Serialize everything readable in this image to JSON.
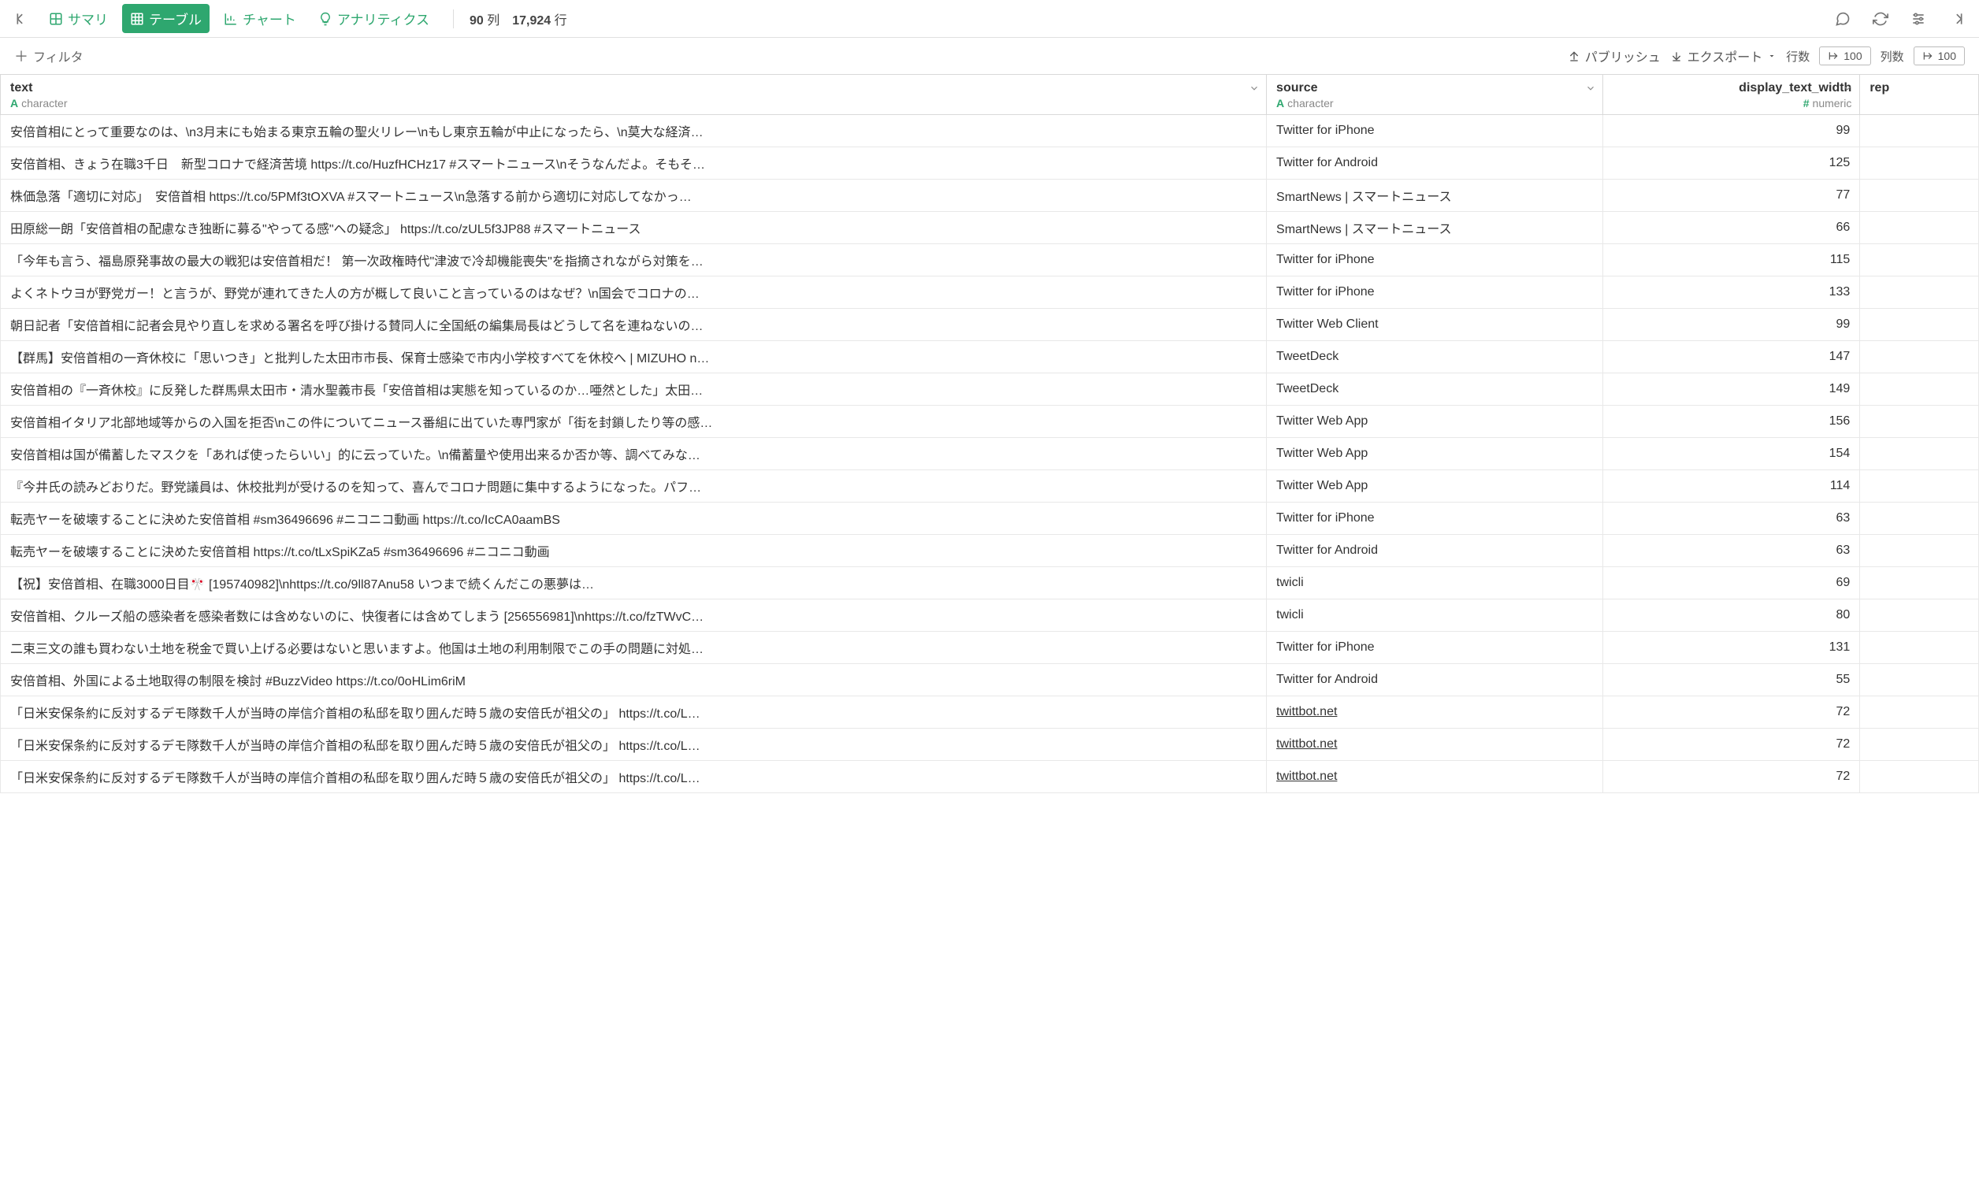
{
  "toolbar": {
    "back_label": "戻る",
    "tabs": {
      "summary": "サマリ",
      "table": "テーブル",
      "chart": "チャート",
      "analytics": "アナリティクス"
    },
    "columns_count": "90",
    "columns_unit": "列",
    "rows_count": "17,924",
    "rows_unit": "行"
  },
  "secondbar": {
    "filter_label": "フィルタ",
    "publish_label": "パブリッシュ",
    "export_label": "エクスポート",
    "rows_label": "行数",
    "cols_label": "列数",
    "rows_value": "100",
    "cols_value": "100"
  },
  "columns": [
    {
      "name": "text",
      "type_label": "character",
      "type_kind": "character"
    },
    {
      "name": "source",
      "type_label": "character",
      "type_kind": "character"
    },
    {
      "name": "display_text_width",
      "type_label": "numeric",
      "type_kind": "numeric"
    },
    {
      "name": "rep",
      "type_label": "",
      "type_kind": ""
    }
  ],
  "rows": [
    {
      "text": "安倍首相にとって重要なのは、\\n3月末にも始まる東京五輪の聖火リレー\\nもし東京五輪が中止になったら、\\n莫大な経済…",
      "source": "Twitter for iPhone",
      "source_link": false,
      "width": "99"
    },
    {
      "text": "安倍首相、きょう在職3千日　新型コロナで経済苦境 https://t.co/HuzfHCHz17 #スマートニュース\\nそうなんだよ。そもそ…",
      "source": "Twitter for Android",
      "source_link": false,
      "width": "125"
    },
    {
      "text": "株価急落「適切に対応」　安倍首相 https://t.co/5PMf3tOXVA #スマートニュース\\n急落する前から適切に対応してなかっ…",
      "source": "SmartNews | スマートニュース",
      "source_link": false,
      "width": "77"
    },
    {
      "text": "田原総一朗「安倍首相の配慮なき独断に募る\"やってる感\"への疑念」 https://t.co/zUL5f3JP88 #スマートニュース",
      "source": "SmartNews | スマートニュース",
      "source_link": false,
      "width": "66"
    },
    {
      "text": "「今年も言う、福島原発事故の最大の戦犯は安倍首相だ！ 第一次政権時代\"津波で冷却機能喪失\"を指摘されながら対策を…",
      "source": "Twitter for iPhone",
      "source_link": false,
      "width": "115"
    },
    {
      "text": "よくネトウヨが野党ガー！と言うが、野党が連れてきた人の方が概して良いこと言っているのはなぜ？\\n国会でコロナの…",
      "source": "Twitter for iPhone",
      "source_link": false,
      "width": "133"
    },
    {
      "text": "朝日記者「安倍首相に記者会見やり直しを求める署名を呼び掛ける賛同人に全国紙の編集局長はどうして名を連ねないの…",
      "source": "Twitter Web Client",
      "source_link": false,
      "width": "99"
    },
    {
      "text": "【群馬】安倍首相の一斉休校に「思いつき」と批判した太田市市長、保育士感染で市内小学校すべてを休校へ | MIZUHO n…",
      "source": "TweetDeck",
      "source_link": false,
      "width": "147"
    },
    {
      "text": "安倍首相の『一斉休校』に反発した群馬県太田市・清水聖義市長「安倍首相は実態を知っているのか…唖然とした」太田…",
      "source": "TweetDeck",
      "source_link": false,
      "width": "149"
    },
    {
      "text": "安倍首相イタリア北部地域等からの入国を拒否\\nこの件についてニュース番組に出ていた専門家が「街を封鎖したり等の感…",
      "source": "Twitter Web App",
      "source_link": false,
      "width": "156"
    },
    {
      "text": "安倍首相は国が備蓄したマスクを「あれば使ったらいい」的に云っていた。\\n備蓄量や使用出来るか否か等、調べてみな…",
      "source": "Twitter Web App",
      "source_link": false,
      "width": "154"
    },
    {
      "text": "『今井氏の読みどおりだ。野党議員は、休校批判が受けるのを知って、喜んでコロナ問題に集中するようになった。パフ…",
      "source": "Twitter Web App",
      "source_link": false,
      "width": "114"
    },
    {
      "text": "転売ヤーを破壊することに決めた安倍首相 #sm36496696 #ニコニコ動画 https://t.co/IcCA0aamBS",
      "source": "Twitter for iPhone",
      "source_link": false,
      "width": "63"
    },
    {
      "text": "転売ヤーを破壊することに決めた安倍首相 https://t.co/tLxSpiKZa5 #sm36496696 #ニコニコ動画",
      "source": "Twitter for Android",
      "source_link": false,
      "width": "63"
    },
    {
      "text": "【祝】安倍首相、在職3000日目🎌 [195740982]\\nhttps://t.co/9ll87Anu58 いつまで続くんだこの悪夢は…",
      "source": "twicli",
      "source_link": false,
      "width": "69"
    },
    {
      "text": "安倍首相、クルーズ船の感染者を感染者数には含めないのに、快復者には含めてしまう [256556981]\\nhttps://t.co/fzTWvC…",
      "source": "twicli",
      "source_link": false,
      "width": "80"
    },
    {
      "text": "二束三文の誰も買わない土地を税金で買い上げる必要はないと思いますよ。他国は土地の利用制限でこの手の問題に対処…",
      "source": "Twitter for iPhone",
      "source_link": false,
      "width": "131"
    },
    {
      "text": "安倍首相、外国による土地取得の制限を検討 #BuzzVideo https://t.co/0oHLim6riM",
      "source": "Twitter for Android",
      "source_link": false,
      "width": "55"
    },
    {
      "text": "「日米安保条約に反対するデモ隊数千人が当時の岸信介首相の私邸を取り囲んだ時５歳の安倍氏が祖父の」 https://t.co/L…",
      "source": "twittbot.net",
      "source_link": true,
      "width": "72"
    },
    {
      "text": "「日米安保条約に反対するデモ隊数千人が当時の岸信介首相の私邸を取り囲んだ時５歳の安倍氏が祖父の」 https://t.co/L…",
      "source": "twittbot.net",
      "source_link": true,
      "width": "72"
    },
    {
      "text": "「日米安保条約に反対するデモ隊数千人が当時の岸信介首相の私邸を取り囲んだ時５歳の安倍氏が祖父の」 https://t.co/L…",
      "source": "twittbot.net",
      "source_link": true,
      "width": "72"
    }
  ]
}
